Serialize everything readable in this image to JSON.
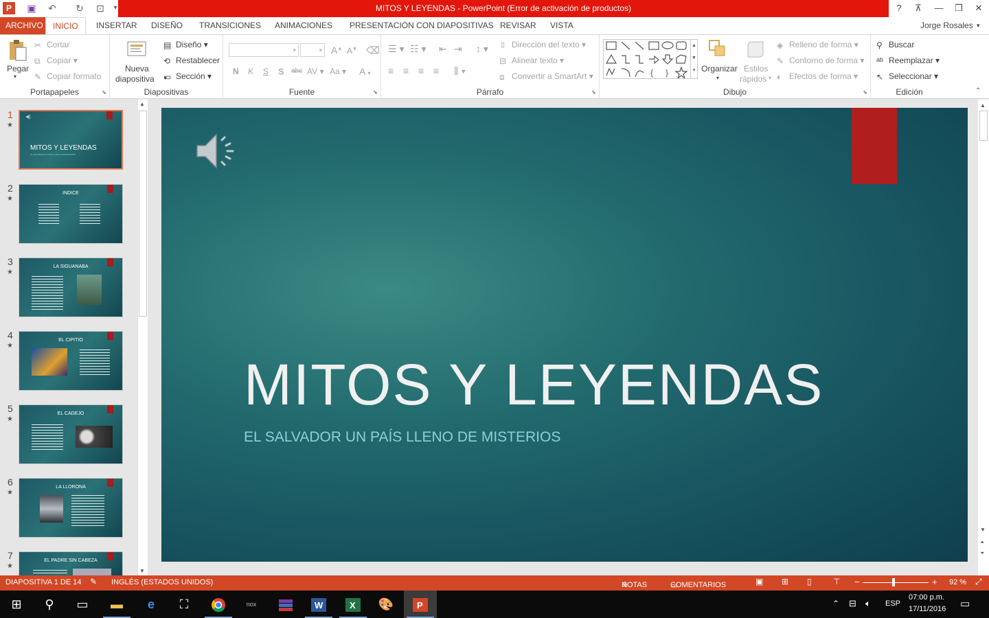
{
  "window": {
    "title": "MITOS Y LEYENDAS -  PowerPoint (Error de activación de productos)",
    "help": "?",
    "min": "—",
    "restore": "❐",
    "close": "✕"
  },
  "tabs": [
    "ARCHIVO",
    "INICIO",
    "INSERTAR",
    "DISEÑO",
    "TRANSICIONES",
    "ANIMACIONES",
    "PRESENTACIÓN CON DIAPOSITIVAS",
    "REVISAR",
    "VISTA"
  ],
  "active_tab": "INICIO",
  "user": "Jorge Rosales",
  "ribbon": {
    "clipboard": {
      "paste": "Pegar",
      "cut": "Cortar",
      "copy": "Copiar",
      "format_painter": "Copiar formato",
      "label": "Portapapeles"
    },
    "slides": {
      "new_slide_1": "Nueva",
      "new_slide_2": "diapositiva",
      "layout": "Diseño",
      "reset": "Restablecer",
      "section": "Sección",
      "label": "Diapositivas"
    },
    "font": {
      "bold": "N",
      "italic": "K",
      "underline": "S",
      "shadow": "S",
      "strike": "abc",
      "spacing": "AV",
      "case": "Aa",
      "color": "A",
      "label": "Fuente"
    },
    "paragraph": {
      "direction": "Dirección del texto",
      "align": "Alinear texto",
      "smartart": "Convertir a SmartArt",
      "label": "Párrafo"
    },
    "drawing": {
      "arrange": "Organizar",
      "quick_styles_1": "Estilos",
      "quick_styles_2": "rápidos",
      "fill": "Relleno de forma",
      "outline": "Contorno de forma",
      "effects": "Efectos de forma",
      "label": "Dibujo"
    },
    "editing": {
      "find": "Buscar",
      "replace": "Reemplazar",
      "select": "Seleccionar",
      "label": "Edición"
    }
  },
  "thumbnails": [
    {
      "num": "1",
      "title": "MITOS Y LEYENDAS",
      "subtitle": "EL SALVADOR UN PAÍS LLENO DE MISTERIOS"
    },
    {
      "num": "2",
      "title": "INDICE"
    },
    {
      "num": "3",
      "title": "LA SIGUANABA"
    },
    {
      "num": "4",
      "title": "EL CIPITIO"
    },
    {
      "num": "5",
      "title": "EL CADEJO"
    },
    {
      "num": "6",
      "title": "LA LLORONA"
    },
    {
      "num": "7",
      "title": "EL PADRE SIN CABEZA"
    }
  ],
  "slide": {
    "title": "MITOS Y LEYENDAS",
    "subtitle": "EL SALVADOR UN PAÍS LLENO DE MISTERIOS"
  },
  "status": {
    "slide_info": "DIAPOSITIVA 1 DE 14",
    "language": "INGLÉS (ESTADOS UNIDOS)",
    "notes": "NOTAS",
    "comments": "COMENTARIOS",
    "zoom": "92 %",
    "zoom_minus": "−",
    "zoom_plus": "+"
  },
  "taskbar": {
    "lang": "ESP",
    "time": "07:00 p.m.",
    "date": "17/11/2016"
  },
  "colors": {
    "accent": "#d24726",
    "titlebar": "#e3160b",
    "slide_red": "#b01e1e"
  }
}
